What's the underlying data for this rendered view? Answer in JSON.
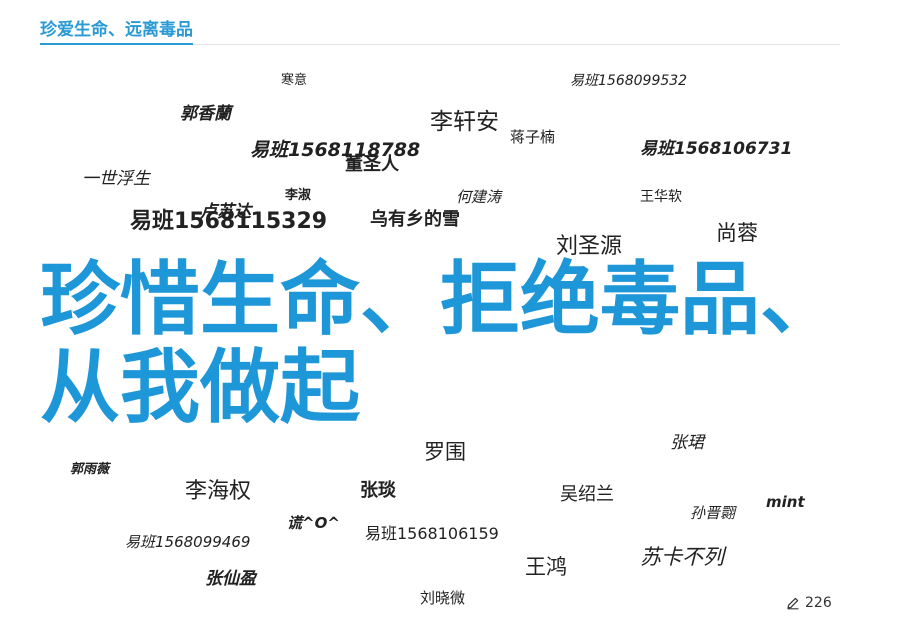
{
  "header": {
    "title": "珍爱生命、远离毒品"
  },
  "headline": {
    "line1": "珍惜生命、拒绝毒品、",
    "line2": "从我做起"
  },
  "words": {
    "w01": "寒意",
    "w02": "易班1568099532",
    "w03": "郭香蘭",
    "w04": "李轩安",
    "w05": "蒋子楠",
    "w06": "易班1568118788",
    "w07": "易班1568106731",
    "w08": "董圣人",
    "w09": "一世浮生",
    "w10": "李淑",
    "w11": "何建涛",
    "w12": "王华软",
    "w13": "卢苏达",
    "w14": "易班1568115329",
    "w15": "乌有乡的雪",
    "w16": "尚蓉",
    "w17": "刘圣源",
    "w18": "罗围",
    "w19": "张珺",
    "w20": "郭雨薇",
    "w21": "李海权",
    "w22": "张琰",
    "w23": "吴绍兰",
    "w24": "mint",
    "w25": "谎^O^",
    "w26": "孙晋翾",
    "w27": "易班1568106159",
    "w28": "易班1568099469",
    "w29": "苏卡不列",
    "w30": "王鸿",
    "w31": "张仙盈",
    "w32": "刘晓微"
  },
  "counter": {
    "icon": "pencil-icon",
    "value": "226"
  },
  "colors": {
    "accent": "#1e97d8",
    "header": "#2a9ad4",
    "text": "#222222"
  }
}
